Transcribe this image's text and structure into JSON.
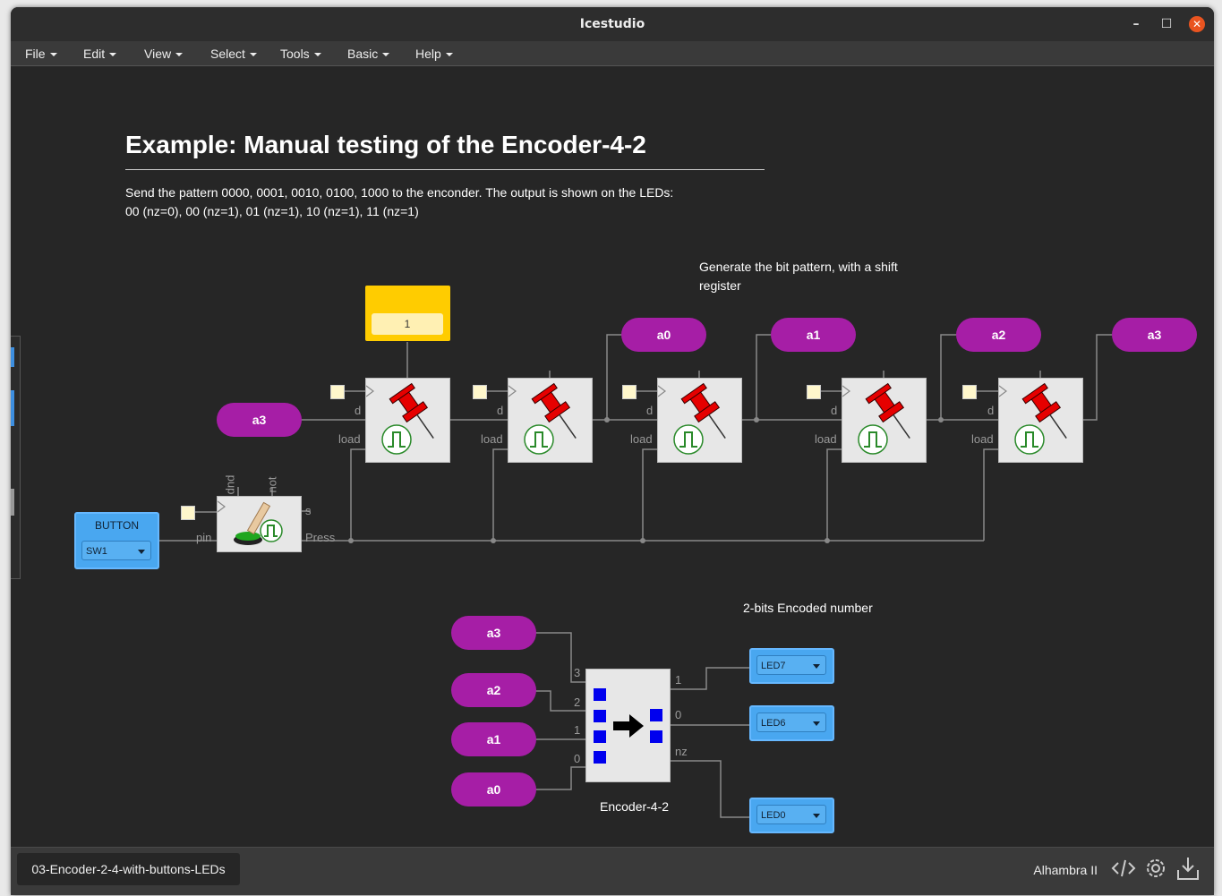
{
  "window": {
    "title": "Icestudio"
  },
  "menu": [
    "File",
    "Edit",
    "View",
    "Select",
    "Tools",
    "Basic",
    "Help"
  ],
  "doc": {
    "title": "Example: Manual testing of the Encoder-4-2",
    "line1": "Send the pattern 0000, 0001, 0010, 0100, 1000 to the enconder. The output is shown on the LEDs:",
    "line2": "00 (nz=0), 00 (nz=1), 01 (nz=1), 10 (nz=1), 11 (nz=1)"
  },
  "comments": {
    "shift_line1": "Generate the bit pattern, with a shift",
    "shift_line2": "register",
    "encoded": "2-bits Encoded number"
  },
  "constant": {
    "value": "1"
  },
  "labels_top": [
    "a0",
    "a1",
    "a2",
    "a3"
  ],
  "label_in": "a3",
  "ports": {
    "d": "d",
    "load": "load",
    "pin": "pin",
    "s": "s",
    "press": "Press",
    "pup": "pup",
    "not": "not"
  },
  "button": {
    "title": "BUTTON",
    "pin": "SW1"
  },
  "encoder_inputs": [
    "a3",
    "a2",
    "a1",
    "a0"
  ],
  "encoder": {
    "name": "Encoder-4-2",
    "in_ports": [
      "3",
      "2",
      "1",
      "0"
    ],
    "out_ports": [
      "1",
      "0",
      "nz"
    ]
  },
  "leds": [
    "LED7",
    "LED6",
    "LED0"
  ],
  "status": {
    "file": "03-Encoder-2-4-with-buttons-LEDs",
    "board": "Alhambra II"
  },
  "colors": {
    "label": "#a61ea6",
    "io": "#49a7f0",
    "constant": "#ffcc00",
    "wire": "#888888"
  },
  "icons": [
    "minimize-icon",
    "maximize-icon",
    "close-icon",
    "pushpin-icon",
    "pulse-icon",
    "button-icon",
    "arrow-icon",
    "code-icon",
    "settings-icon",
    "download-icon"
  ]
}
